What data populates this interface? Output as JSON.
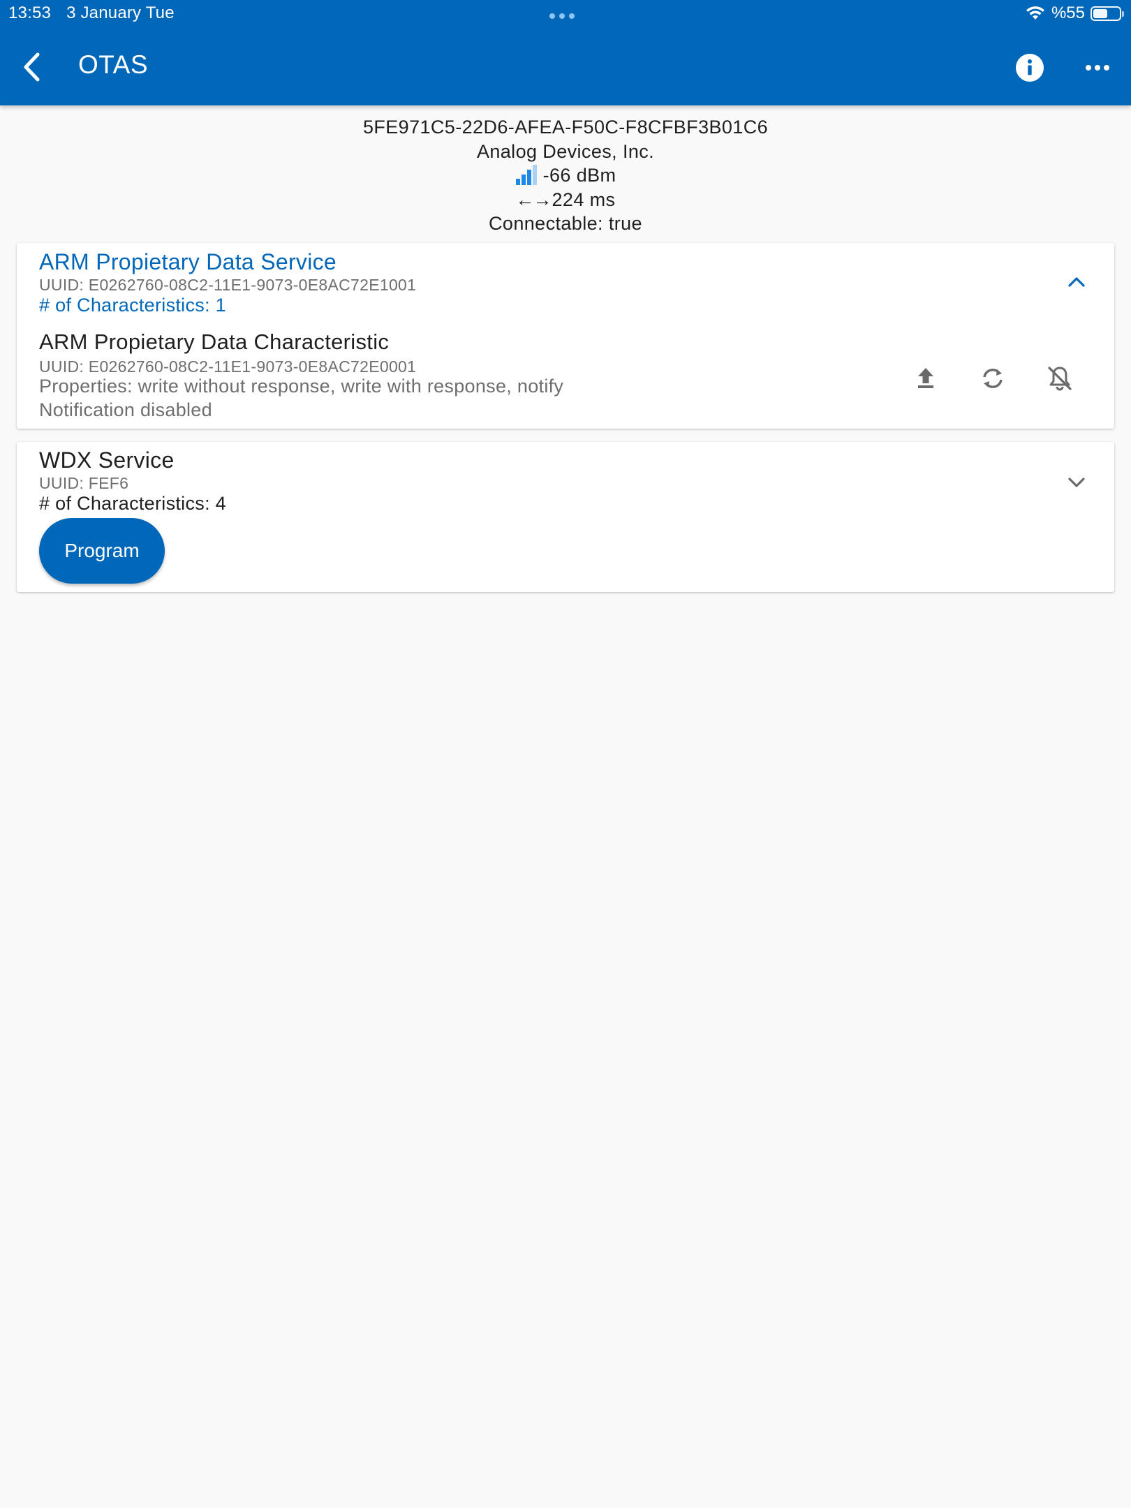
{
  "status_bar": {
    "time": "13:53",
    "date": "3 January Tue",
    "battery_text": "%55",
    "battery_level": 0.55,
    "icons": [
      "wifi-icon",
      "battery-icon"
    ]
  },
  "app_bar": {
    "title": "OTAS",
    "back_icon": "chevron-left-icon",
    "info_icon": "info-icon",
    "more_icon": "more-horizontal-icon",
    "color": "#0067b9"
  },
  "device": {
    "id": "5FE971C5-22D6-AFEA-F50C-F8CFBF3B01C6",
    "manufacturer": "Analog Devices, Inc.",
    "rssi": "-66 dBm",
    "interval_arrows": "←→",
    "interval": "224 ms",
    "connectable": "Connectable: true"
  },
  "services": [
    {
      "name": "ARM Propietary Data Service",
      "uuid": "UUID: E0262760-08C2-11E1-9073-0E8AC72E1001",
      "count": "# of Characteristics: 1",
      "expanded": true,
      "characteristics": [
        {
          "name": "ARM Propietary Data Characteristic",
          "uuid": "UUID: E0262760-08C2-11E1-9073-0E8AC72E0001",
          "properties": "Properties: write without response, write with response, notify",
          "notification": "Notification disabled",
          "actions": [
            "upload-icon",
            "refresh-icon",
            "notifications-off-icon"
          ]
        }
      ]
    },
    {
      "name": "WDX Service",
      "uuid": "UUID: FEF6",
      "count": "# of Characteristics: 4",
      "expanded": false,
      "button_label": "Program"
    }
  ],
  "colors": {
    "accent": "#0067b9",
    "secondary_text": "#6e6e6e",
    "icon_gray": "#6a6a6a",
    "background": "#f9f9f9"
  }
}
